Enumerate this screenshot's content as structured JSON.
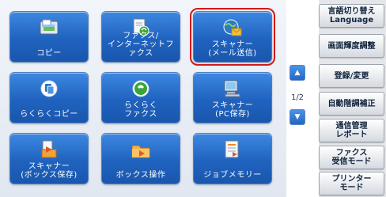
{
  "main": {
    "tiles": [
      {
        "label": "コピー",
        "icon": "copy-icon"
      },
      {
        "label": "ファクス/\nインターネットファクス",
        "icon": "fax-icon"
      },
      {
        "label": "スキャナー\n(メール送信)",
        "icon": "scanner-email-icon"
      },
      {
        "label": "らくらくコピー",
        "icon": "easy-copy-icon"
      },
      {
        "label": "らくらく\nファクス",
        "icon": "easy-fax-icon"
      },
      {
        "label": "スキャナー\n(PC保存)",
        "icon": "scanner-pc-icon"
      },
      {
        "label": "スキャナー\n(ボックス保存)",
        "icon": "scanner-box-icon"
      },
      {
        "label": "ボックス操作",
        "icon": "box-operation-icon"
      },
      {
        "label": "ジョブメモリー",
        "icon": "job-memory-icon"
      }
    ],
    "selected_tile": "スキャナー\n(メール送信)"
  },
  "pager": {
    "page": "1/2",
    "up_icon": "triangle-up-icon",
    "down_icon": "triangle-down-icon"
  },
  "side": {
    "buttons": [
      {
        "label": "言語切り替え\nLanguage"
      },
      {
        "label": "画面輝度調整"
      },
      {
        "label": "登録/変更"
      },
      {
        "label": "自動階調補正"
      },
      {
        "label": "通信管理\nレポート"
      },
      {
        "label": "ファクス\n受信モード"
      },
      {
        "label": "プリンター\nモード"
      }
    ]
  },
  "colors": {
    "tile": "#1f63bf",
    "selection": "#d21919",
    "side_button": "#e7eaee"
  }
}
